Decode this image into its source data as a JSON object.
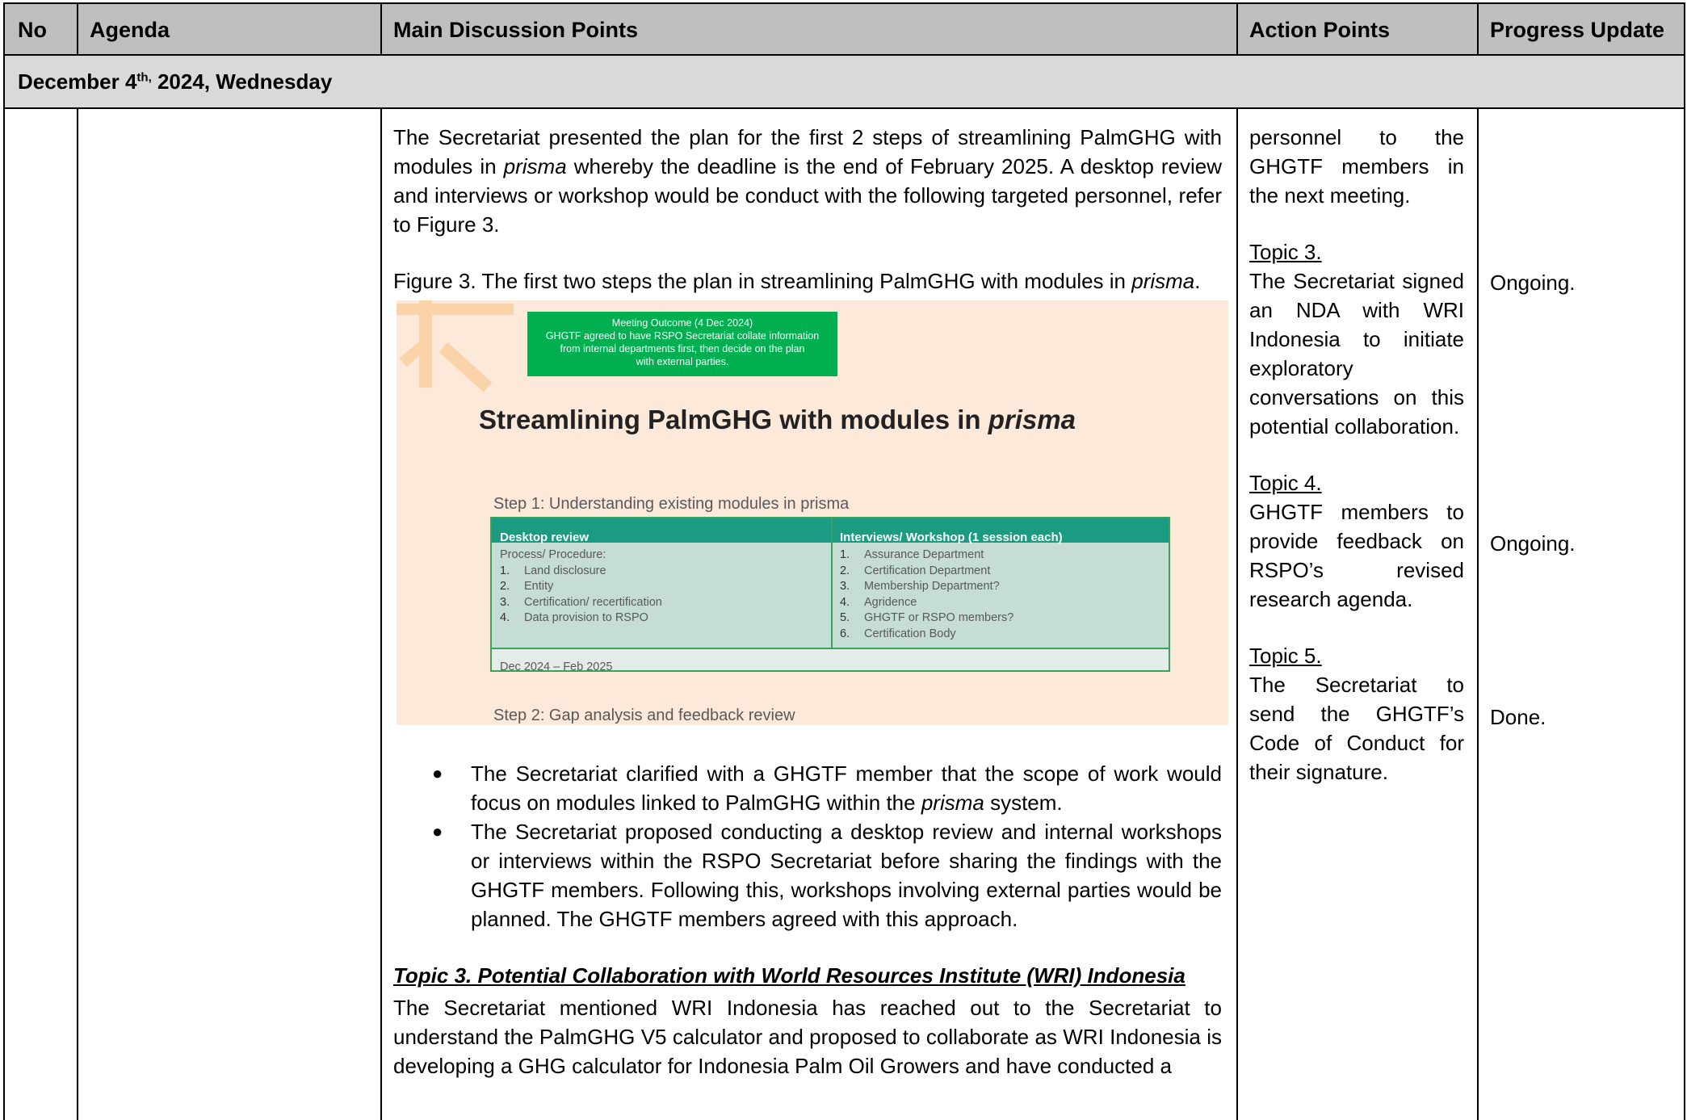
{
  "table": {
    "headers": {
      "no": "No",
      "agenda": "Agenda",
      "main": "Main Discussion Points",
      "action": "Action Points",
      "progress": "Progress Update"
    },
    "date_row": {
      "prefix": "December 4",
      "sup": "th,",
      "suffix": " 2024, Wednesday"
    }
  },
  "main": {
    "intro_pre": "The Secretariat presented the plan for the first 2 steps of streamlining PalmGHG with modules in ",
    "intro_em": "prisma",
    "intro_post": " whereby the deadline is the end of February 2025. A desktop review and interviews or workshop would be conduct with the following targeted personnel, refer to Figure 3.",
    "fig_caption_pre": "Figure 3. The first two steps the plan in streamlining PalmGHG with modules in ",
    "fig_caption_em": "prisma",
    "fig_caption_post": ".",
    "bullets": [
      {
        "pre": "The Secretariat clarified with a GHGTF member that the scope of work would focus on modules linked to PalmGHG within the ",
        "em": "prisma",
        "post": " system."
      },
      {
        "pre": "The Secretariat proposed conducting a desktop review and internal workshops or interviews within the RSPO Secretariat before sharing the findings with the GHGTF members. Following this, workshops involving external parties would be planned. The GHGTF members agreed with this approach.",
        "em": "",
        "post": ""
      }
    ],
    "topic3_heading": "Topic 3. Potential Collaboration with World Resources Institute (WRI) Indonesia",
    "topic3_text": "The Secretariat mentioned WRI Indonesia has reached out to the Secretariat to understand the PalmGHG V5 calculator and proposed to collaborate as WRI Indonesia is developing a GHG calculator for Indonesia Palm Oil Growers and have conducted a"
  },
  "figure": {
    "outcome": [
      "Meeting Outcome (4 Dec 2024)",
      "GHGTF agreed to have RSPO Secretariat collate information",
      "from internal departments first, then decide on the plan",
      "with external parties."
    ],
    "title_pre": "Streamlining PalmGHG with modules in ",
    "title_em": "prisma",
    "step1": "Step 1: Understanding existing modules in prisma",
    "col1_header": "Desktop review",
    "col2_header": "Interviews/ Workshop (1 session each)",
    "col1_intro": "Process/ Procedure:",
    "col1_items": [
      "Land disclosure",
      "Entity",
      "Certification/ recertification",
      "Data provision to RSPO"
    ],
    "col2_items": [
      "Assurance Department",
      "Certification Department",
      "Membership Department?",
      "Agridence",
      "GHGTF or RSPO members?",
      "Certification Body"
    ],
    "timeline": "Dec 2024 – Feb 2025",
    "step2": "Step 2: Gap analysis and feedback review"
  },
  "action": {
    "cont": "personnel to the GHGTF members in the next meeting.",
    "topic3_label": "Topic 3.",
    "topic3_text": "The Secretariat signed an NDA with WRI Indonesia to initiate exploratory conversations on this potential collaboration.",
    "topic4_label": "Topic 4.",
    "topic4_text": "GHGTF members to provide feedback on RSPO’s revised research agenda.",
    "topic5_label": "Topic 5.",
    "topic5_text": "The Secretariat to send the GHGTF’s Code of Conduct for their signature."
  },
  "progress": {
    "topic3": "Ongoing.",
    "topic4": "Ongoing.",
    "topic5": "Done."
  }
}
